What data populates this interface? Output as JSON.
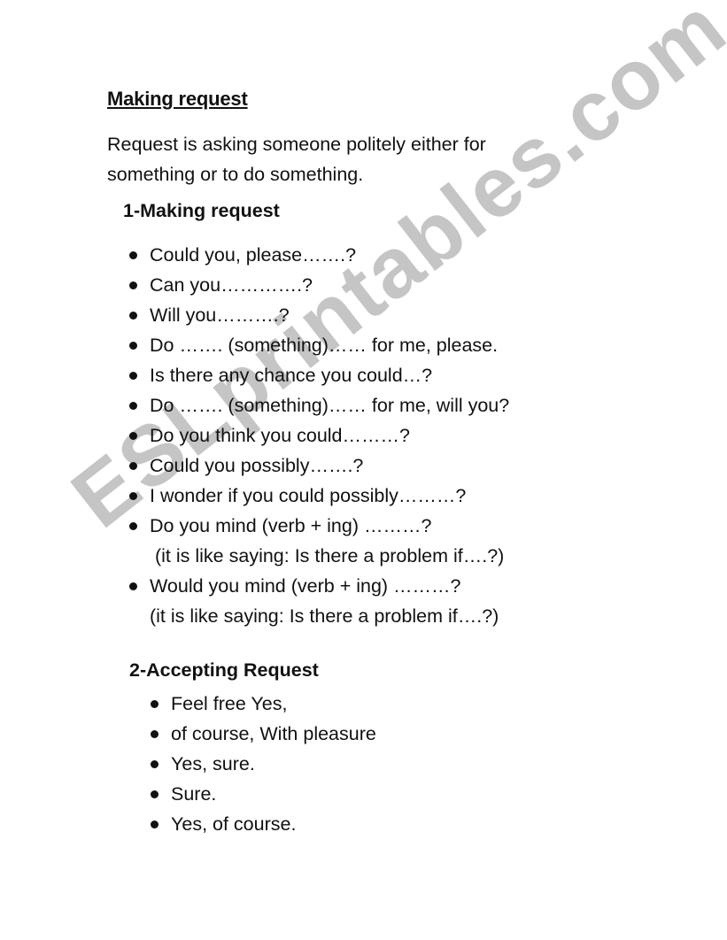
{
  "document": {
    "title": "Making request",
    "intro": "Request is asking someone politely either for something or to do something.",
    "sections": [
      {
        "heading": "1-Making request",
        "items": [
          {
            "text": "Could you, please…….?"
          },
          {
            "text": "Can you………….?"
          },
          {
            "text": "Will you……….?"
          },
          {
            "text": "Do ……. (something)…… for me, please."
          },
          {
            "text": "Is there any chance you could…?"
          },
          {
            "text": "Do ……. (something)…… for me, will you?"
          },
          {
            "text": "Do you think you could………?"
          },
          {
            "text": "Could you possibly…….?"
          },
          {
            "text": "I wonder if you could possibly………?"
          },
          {
            "text": "Do you mind (verb + ing) ………?",
            "note": "(it is like saying: Is there a problem if….?)"
          },
          {
            "text": "Would you mind (verb + ing) ………?",
            "note": "(it is like saying: Is there a problem if….?)"
          }
        ]
      },
      {
        "heading": "2-Accepting Request",
        "items": [
          {
            "text": "Feel free Yes,"
          },
          {
            "text": "of course, With pleasure"
          },
          {
            "text": "Yes, sure."
          },
          {
            "text": "Sure."
          },
          {
            "text": "Yes, of course."
          }
        ]
      }
    ]
  },
  "watermark": {
    "text": "ESLprintables.com",
    "color": "#b4b4b4"
  }
}
